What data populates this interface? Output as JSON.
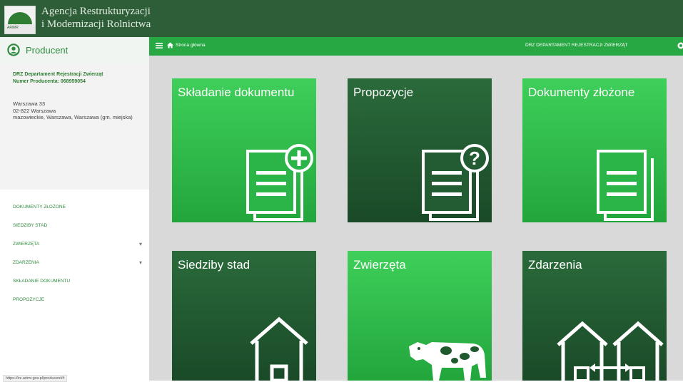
{
  "header": {
    "agency_line1": "Agencja Restrukturyzacji",
    "agency_line2": "i Modernizacji Rolnictwa",
    "logo_text": "ARiMR"
  },
  "sidebar": {
    "profile_label": "Producent",
    "department_line1": "DRZ Departament Rejestracji Zwierząt",
    "department_line2": "Numer Producenta: 068959054",
    "address_line1": "Warszawa 33",
    "address_line2": "02-822 Warszawa",
    "address_line3": "mazowieckie, Warszawa, Warszawa (gm. miejska)",
    "menu": [
      {
        "label": "DOKUMENTY ZŁOŻONE",
        "expandable": false
      },
      {
        "label": "SIEDZIBY STAD",
        "expandable": false
      },
      {
        "label": "ZWIERZĘTA",
        "expandable": true
      },
      {
        "label": "ZDARZENIA",
        "expandable": true
      },
      {
        "label": "SKŁADANIE DOKUMENTU",
        "expandable": false
      },
      {
        "label": "PROPOZYCJE",
        "expandable": false
      }
    ],
    "status_url": "https://irz.arimr.gov.pl/producent/#"
  },
  "navbar": {
    "home_label": "Strona główna",
    "department_label": "DRZ DEPARTAMENT REJESTRACJI ZWIERZĄT"
  },
  "tiles": [
    {
      "title": "Składanie dokumentu",
      "icon": "document-add-icon",
      "style": "light"
    },
    {
      "title": "Propozycje",
      "icon": "document-question-icon",
      "style": "dark"
    },
    {
      "title": "Dokumenty złożone",
      "icon": "documents-icon",
      "style": "light"
    },
    {
      "title": "Siedziby stad",
      "icon": "house-icon",
      "style": "dark"
    },
    {
      "title": "Zwierzęta",
      "icon": "cow-icon",
      "style": "light"
    },
    {
      "title": "Zdarzenia",
      "icon": "houses-transfer-icon",
      "style": "dark"
    }
  ],
  "colors": {
    "header_bg": "#2e5e37",
    "navbar_bg": "#27a843",
    "tile_light": "#2fbf4c",
    "tile_dark": "#21553002",
    "content_bg": "#d9d9d9",
    "accent_text": "#2e8b3e"
  }
}
